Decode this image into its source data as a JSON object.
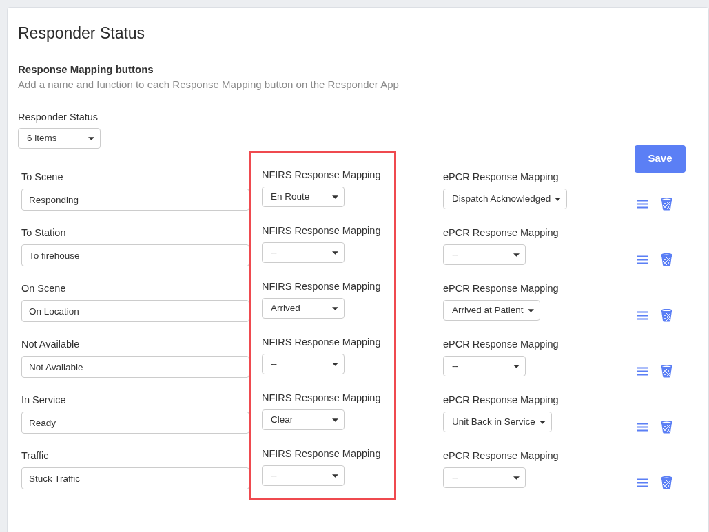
{
  "title": "Responder Status",
  "section": {
    "heading": "Response Mapping buttons",
    "description": "Add a name and function to each Response Mapping button on the Responder App"
  },
  "status_select": {
    "label": "Responder Status",
    "value": "6 items"
  },
  "save_button": "Save",
  "rows": [
    {
      "label": "To Scene",
      "value": "Responding",
      "nfirs_label": "NFIRS Response Mapping",
      "nfirs": "En Route",
      "epcr_label": "ePCR Response Mapping",
      "epcr": "Dispatch Acknowledged"
    },
    {
      "label": "To Station",
      "value": "To firehouse",
      "nfirs_label": "NFIRS Response Mapping",
      "nfirs": "--",
      "epcr_label": "ePCR Response Mapping",
      "epcr": "--"
    },
    {
      "label": "On Scene",
      "value": "On Location",
      "nfirs_label": "NFIRS Response Mapping",
      "nfirs": "Arrived",
      "epcr_label": "ePCR Response Mapping",
      "epcr": "Arrived at Patient"
    },
    {
      "label": "Not Available",
      "value": "Not Available",
      "nfirs_label": "NFIRS Response Mapping",
      "nfirs": "--",
      "epcr_label": "ePCR Response Mapping",
      "epcr": "--"
    },
    {
      "label": "In Service",
      "value": "Ready",
      "nfirs_label": "NFIRS Response Mapping",
      "nfirs": "Clear",
      "epcr_label": "ePCR Response Mapping",
      "epcr": "Unit Back in Service"
    },
    {
      "label": "Traffic",
      "value": "Stuck Traffic",
      "nfirs_label": "NFIRS Response Mapping",
      "nfirs": "--",
      "epcr_label": "ePCR Response Mapping",
      "epcr": "--"
    }
  ]
}
